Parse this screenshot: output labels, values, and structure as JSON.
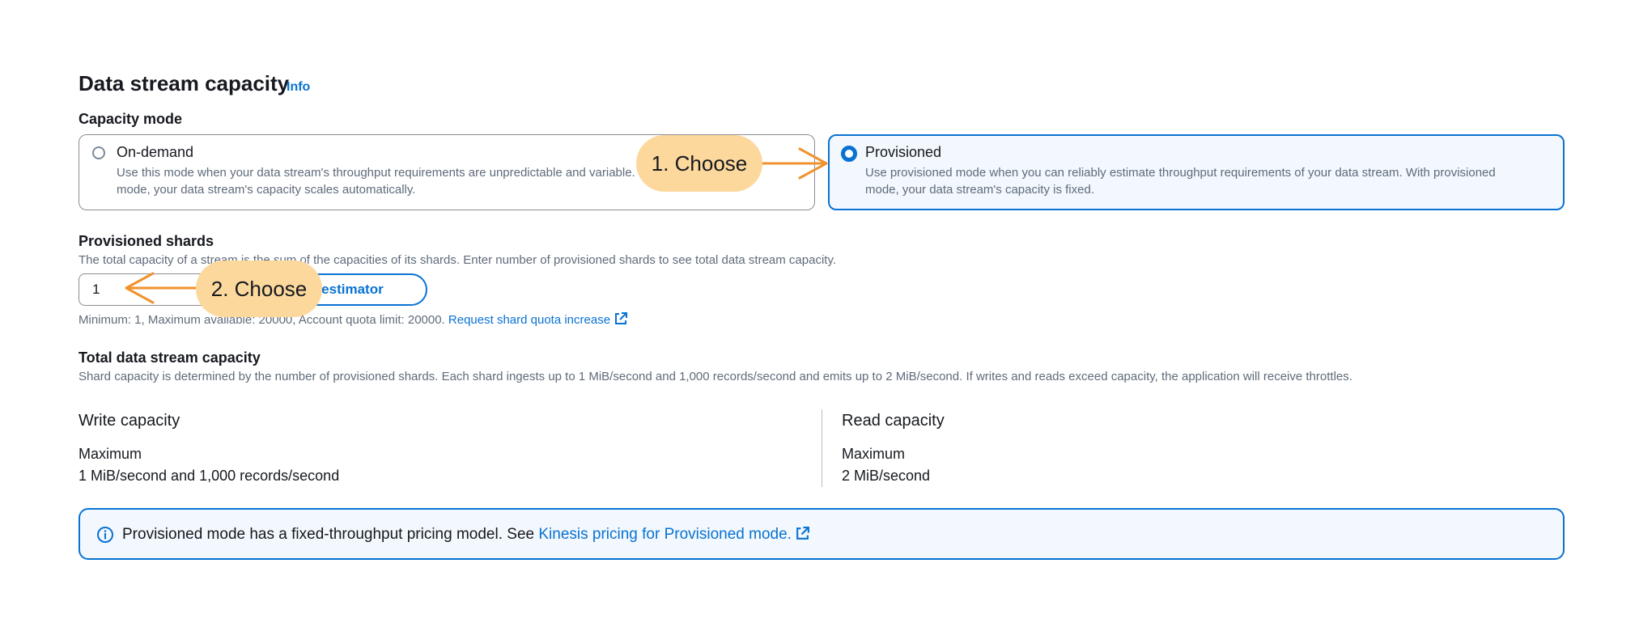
{
  "section": {
    "title": "Data stream capacity",
    "info_link": "Info"
  },
  "capacity_mode": {
    "label": "Capacity mode",
    "options": [
      {
        "title": "On-demand",
        "desc_line1": "Use this mode when your data stream's throughput requirements are unpredictable and variable. With on-demand",
        "desc_line2": "mode, your data stream's capacity scales automatically.",
        "selected": false
      },
      {
        "title": "Provisioned",
        "desc_line1": "Use provisioned mode when you can reliably estimate throughput requirements of your data stream. With provisioned",
        "desc_line2": "mode, your data stream's capacity is fixed.",
        "selected": true
      }
    ]
  },
  "provisioned_shards": {
    "label": "Provisioned shards",
    "description": "The total capacity of a stream is the sum of the capacities of its shards. Enter number of provisioned shards to see total data stream capacity.",
    "value": "1",
    "estimator_button": "Shard estimator",
    "constraint": "Minimum: 1, Maximum available: 20000, Account quota limit: 20000.",
    "quota_link": "Request shard quota increase"
  },
  "total_capacity": {
    "label": "Total data stream capacity",
    "description": "Shard capacity is determined by the number of provisioned shards. Each shard ingests up to 1 MiB/second and 1,000 records/second and emits up to 2 MiB/second. If writes and reads exceed capacity, the application will receive throttles.",
    "write": {
      "title": "Write capacity",
      "key": "Maximum",
      "value": "1 MiB/second and 1,000 records/second"
    },
    "read": {
      "title": "Read capacity",
      "key": "Maximum",
      "value": "2 MiB/second"
    }
  },
  "alert": {
    "text": "Provisioned mode has a fixed-throughput pricing model. See",
    "link": "Kinesis pricing for Provisioned mode."
  },
  "annotations": {
    "step1": "1. Choose",
    "step2": "2. Choose"
  },
  "colors": {
    "accent": "#0972d3",
    "callout": "#fcd89d",
    "arrow": "#f0922e",
    "selected_bg": "#f2f8fd"
  },
  "icons": [
    "info-icon",
    "external-link-icon",
    "radio-unselected-icon",
    "radio-selected-icon",
    "arrow-icon"
  ]
}
